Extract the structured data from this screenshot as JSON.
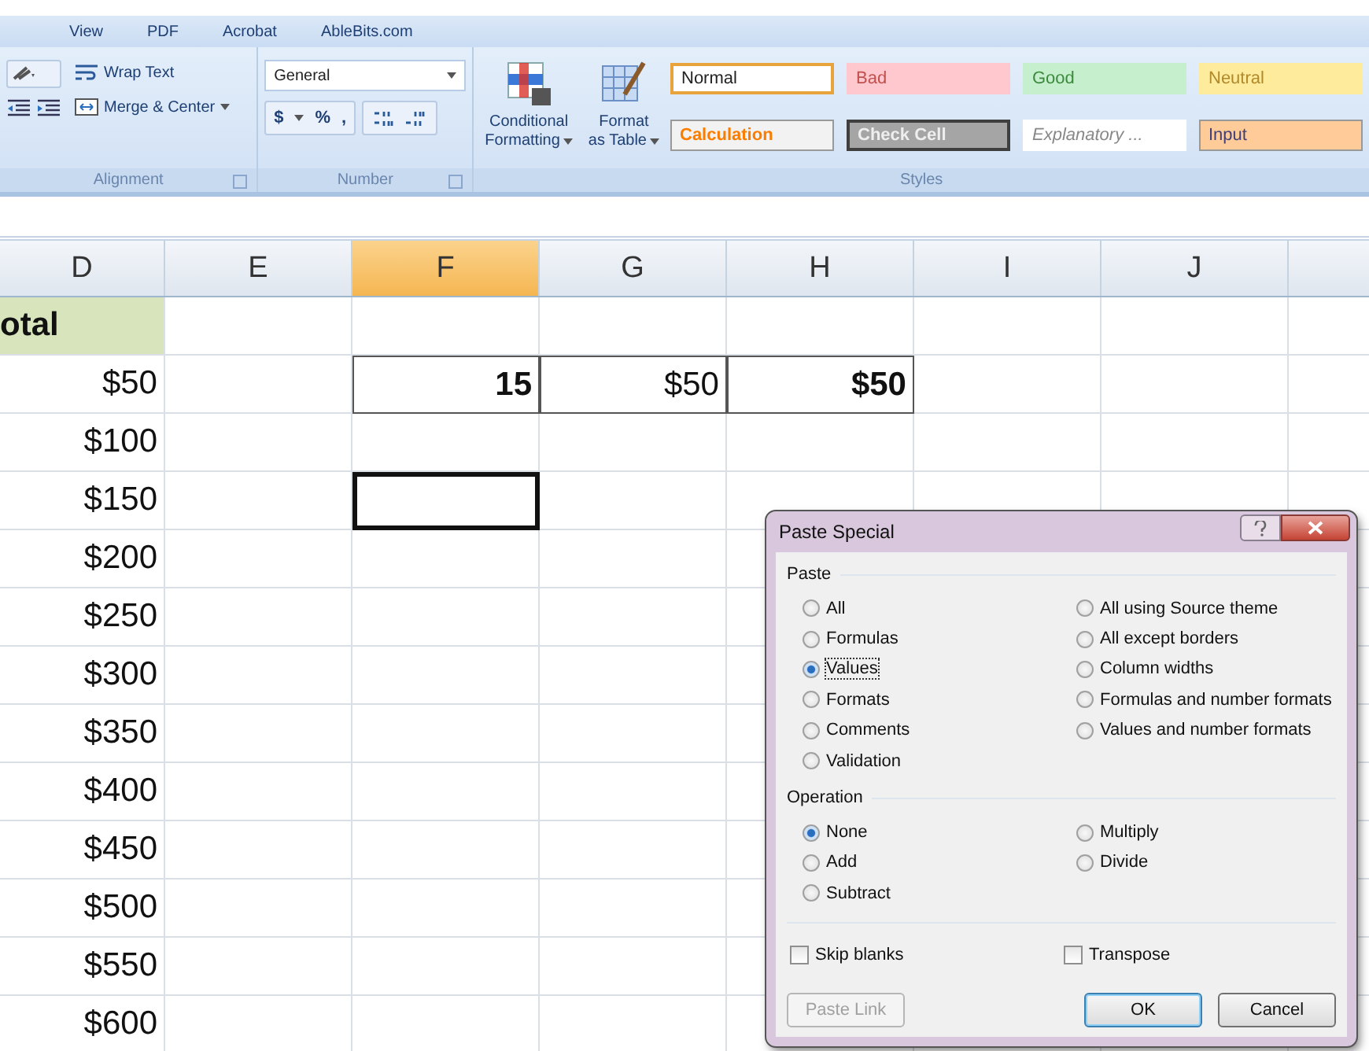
{
  "ribbon": {
    "tabs": [
      {
        "label": "View"
      },
      {
        "label": "PDF"
      },
      {
        "label": "Acrobat"
      },
      {
        "label": "AbleBits.com"
      }
    ],
    "alignment": {
      "wrap_text": "Wrap Text",
      "merge_center": "Merge & Center",
      "group_label": "Alignment"
    },
    "number": {
      "format": "General",
      "currency": "$",
      "percent": "%",
      "comma": ",",
      "group_label": "Number"
    },
    "table_buttons": [
      {
        "kind": "conditional",
        "line1": "Conditional",
        "line2": "Formatting"
      },
      {
        "kind": "table",
        "line1": "Format",
        "line2": "as Table"
      }
    ],
    "styles": {
      "group_label": "Styles",
      "items": [
        {
          "label": "Normal",
          "kind": "normal",
          "selected": true
        },
        {
          "label": "Bad",
          "kind": "bad",
          "selected": false
        },
        {
          "label": "Good",
          "kind": "good",
          "selected": false
        },
        {
          "label": "Neutral",
          "kind": "neutral",
          "selected": false
        },
        {
          "label": "Calculation",
          "kind": "calculation",
          "selected": false
        },
        {
          "label": "Check Cell",
          "kind": "check",
          "selected": false
        },
        {
          "label": "Explanatory ...",
          "kind": "explanatory",
          "selected": false
        },
        {
          "label": "Input",
          "kind": "input",
          "selected": false
        }
      ]
    }
  },
  "sheet": {
    "columns": [
      {
        "label": "D",
        "selected": false
      },
      {
        "label": "E",
        "selected": false
      },
      {
        "label": "F",
        "selected": true
      },
      {
        "label": "G",
        "selected": false
      },
      {
        "label": "H",
        "selected": false
      },
      {
        "label": "I",
        "selected": false
      },
      {
        "label": "J",
        "selected": false
      }
    ],
    "rows": [
      {
        "d": {
          "text": "otal",
          "kind": "header",
          "bold": true,
          "selected": false
        }
      },
      {
        "d": {
          "text": "$50",
          "bold": false,
          "selected": false
        },
        "f": {
          "text": "15",
          "bold": true,
          "boxed": true,
          "selected": false
        },
        "g": {
          "text": "$50",
          "bold": false,
          "boxed": true,
          "selected": false
        },
        "h": {
          "text": "$50",
          "bold": true,
          "boxed": true,
          "selected": false
        }
      },
      {
        "d": {
          "text": "$100",
          "bold": false,
          "selected": false
        }
      },
      {
        "d": {
          "text": "$150",
          "bold": false,
          "selected": false
        },
        "f": {
          "selected": true
        }
      },
      {
        "d": {
          "text": "$200",
          "bold": false,
          "selected": false
        }
      },
      {
        "d": {
          "text": "$250",
          "bold": false,
          "selected": false
        }
      },
      {
        "d": {
          "text": "$300",
          "bold": false,
          "selected": false
        }
      },
      {
        "d": {
          "text": "$350",
          "bold": false,
          "selected": false
        }
      },
      {
        "d": {
          "text": "$400",
          "bold": false,
          "selected": false
        }
      },
      {
        "d": {
          "text": "$450",
          "bold": false,
          "selected": false
        }
      },
      {
        "d": {
          "text": "$500",
          "bold": false,
          "selected": false
        }
      },
      {
        "d": {
          "text": "$550",
          "bold": false,
          "selected": false
        }
      },
      {
        "d": {
          "text": "$600",
          "bold": false,
          "selected": false
        }
      }
    ]
  },
  "dialog": {
    "title": "Paste Special",
    "paste": {
      "label": "Paste",
      "columns": [
        {
          "options": [
            {
              "label": "All",
              "selected": false
            },
            {
              "label": "Formulas",
              "selected": false
            },
            {
              "label": "Values",
              "selected": true
            },
            {
              "label": "Formats",
              "selected": false
            },
            {
              "label": "Comments",
              "selected": false
            },
            {
              "label": "Validation",
              "selected": false
            }
          ]
        },
        {
          "options": [
            {
              "label": "All using Source theme",
              "selected": false
            },
            {
              "label": "All except borders",
              "selected": false
            },
            {
              "label": "Column widths",
              "selected": false
            },
            {
              "label": "Formulas and number formats",
              "selected": false
            },
            {
              "label": "Values and number formats",
              "selected": false
            }
          ]
        }
      ]
    },
    "operation": {
      "label": "Operation",
      "columns": [
        {
          "options": [
            {
              "label": "None",
              "selected": true
            },
            {
              "label": "Add",
              "selected": false
            },
            {
              "label": "Subtract",
              "selected": false
            }
          ]
        },
        {
          "options": [
            {
              "label": "Multiply",
              "selected": false
            },
            {
              "label": "Divide",
              "selected": false
            }
          ]
        }
      ]
    },
    "checkboxes": [
      {
        "label": "Skip blanks",
        "checked": false
      },
      {
        "label": "Transpose",
        "checked": false
      }
    ],
    "buttons": [
      {
        "label": "Paste Link",
        "kind": "link",
        "disabled": true
      },
      {
        "label": "OK",
        "kind": "default",
        "disabled": false
      },
      {
        "label": "Cancel",
        "kind": "cancel",
        "disabled": false
      }
    ]
  }
}
